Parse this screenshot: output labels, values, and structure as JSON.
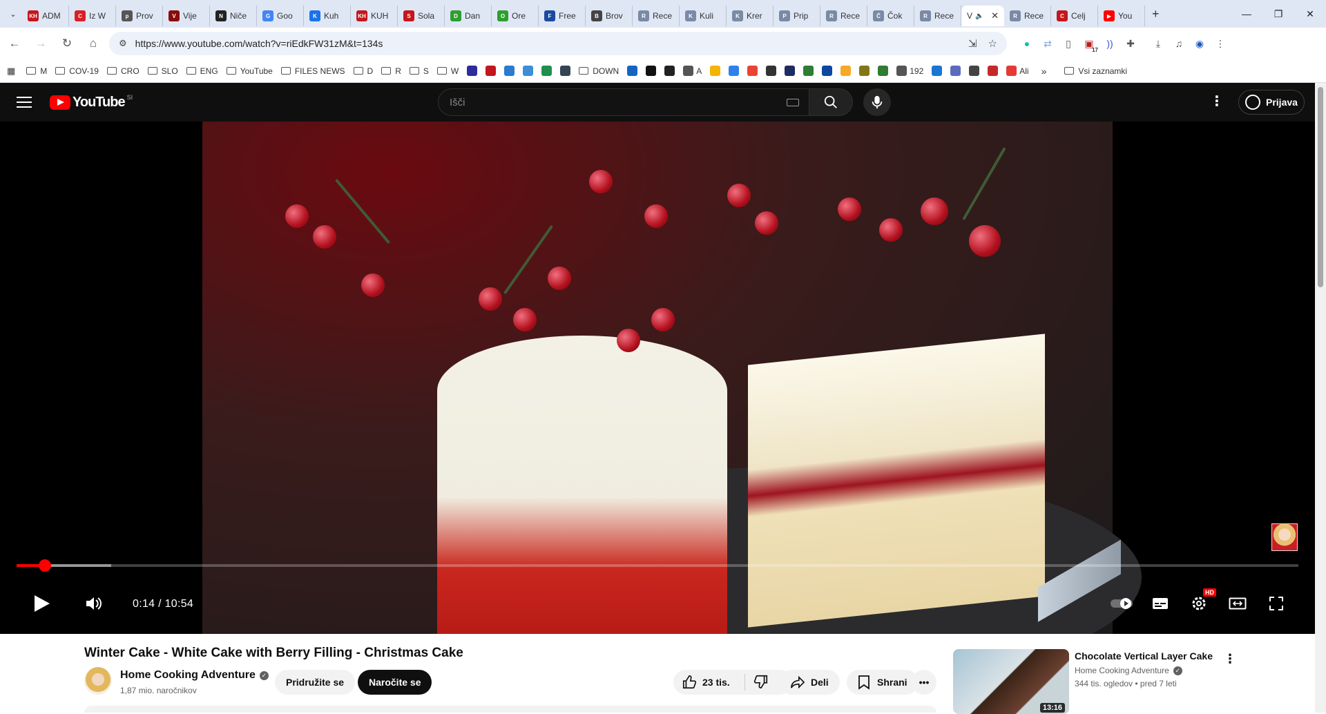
{
  "browser": {
    "tabs": [
      {
        "label": "ADM",
        "color": "#c4161c",
        "fav": "KH"
      },
      {
        "label": "Iz W",
        "color": "#d91f26",
        "fav": "C"
      },
      {
        "label": "Prov",
        "color": "#555555",
        "fav": "p"
      },
      {
        "label": "Vije",
        "color": "#8a0b0b",
        "fav": "V"
      },
      {
        "label": "Niče",
        "color": "#222222",
        "fav": "N"
      },
      {
        "label": "Goo",
        "color": "#4285f4",
        "fav": "G"
      },
      {
        "label": "Kuh",
        "color": "#1a73e8",
        "fav": "K"
      },
      {
        "label": "KUH",
        "color": "#c4161c",
        "fav": "KH"
      },
      {
        "label": "Sola",
        "color": "#c4161c",
        "fav": "S"
      },
      {
        "label": "Dan",
        "color": "#2e9e2e",
        "fav": "D"
      },
      {
        "label": "Ore",
        "color": "#2e9e2e",
        "fav": "O"
      },
      {
        "label": "Free",
        "color": "#1b4aa1",
        "fav": "F"
      },
      {
        "label": "Brov",
        "color": "#444444",
        "fav": "B"
      },
      {
        "label": "Rece",
        "color": "#7a8aa6",
        "fav": "R"
      },
      {
        "label": "Kuli",
        "color": "#7a8aa6",
        "fav": "K"
      },
      {
        "label": "Krer",
        "color": "#7a8aa6",
        "fav": "K"
      },
      {
        "label": "Prip",
        "color": "#7a8aa6",
        "fav": "P"
      },
      {
        "label": "Rece",
        "color": "#7a8aa6",
        "fav": "R"
      },
      {
        "label": "Čok",
        "color": "#7a8aa6",
        "fav": "Č"
      },
      {
        "label": "Rece",
        "color": "#7a8aa6",
        "fav": "R"
      }
    ],
    "active_tab": "V",
    "tabs_after": [
      {
        "label": "Rece",
        "color": "#7a8aa6",
        "fav": "R"
      },
      {
        "label": "Celj",
        "color": "#c4161c",
        "fav": "C"
      },
      {
        "label": "You",
        "color": "#ff0000",
        "fav": "▶"
      }
    ],
    "new_tab": "+",
    "url": "https://www.youtube.com/watch?v=riEdkFW31zM&t=134s",
    "ext_badge": "17",
    "bookmarks": [
      {
        "label": "M",
        "type": "folder"
      },
      {
        "label": "COV-19",
        "type": "folder"
      },
      {
        "label": "CRO",
        "type": "folder"
      },
      {
        "label": "SLO",
        "type": "folder"
      },
      {
        "label": "ENG",
        "type": "folder"
      },
      {
        "label": "YouTube",
        "type": "folder"
      },
      {
        "label": "FILES NEWS",
        "type": "folder"
      },
      {
        "label": "D",
        "type": "folder"
      },
      {
        "label": "R",
        "type": "folder"
      },
      {
        "label": "S",
        "type": "folder"
      },
      {
        "label": "W",
        "type": "folder"
      },
      {
        "label": "",
        "type": "icon",
        "color": "#2c2c9c"
      },
      {
        "label": "",
        "type": "icon",
        "color": "#c4161c"
      },
      {
        "label": "",
        "type": "icon",
        "color": "#2b7bd0"
      },
      {
        "label": "",
        "type": "icon",
        "color": "#3a8fd6"
      },
      {
        "label": "",
        "type": "icon",
        "color": "#1f8f4e"
      },
      {
        "label": "",
        "type": "icon",
        "color": "#334455"
      },
      {
        "label": "DOWN",
        "type": "folder"
      },
      {
        "label": "",
        "type": "icon",
        "color": "#1565c0"
      },
      {
        "label": "",
        "type": "icon",
        "color": "#111111"
      },
      {
        "label": "",
        "type": "icon",
        "color": "#222222"
      },
      {
        "label": "A",
        "type": "icon",
        "color": "#555555"
      },
      {
        "label": "",
        "type": "icon",
        "color": "#f4b400"
      },
      {
        "label": "",
        "type": "icon",
        "color": "#2f80ed"
      },
      {
        "label": "",
        "type": "icon",
        "color": "#ea4335"
      },
      {
        "label": "",
        "type": "icon",
        "color": "#333333"
      },
      {
        "label": "",
        "type": "icon",
        "color": "#1d2b64"
      },
      {
        "label": "",
        "type": "icon",
        "color": "#2e7d32"
      },
      {
        "label": "",
        "type": "icon",
        "color": "#0d47a1"
      },
      {
        "label": "",
        "type": "icon",
        "color": "#f9a825"
      },
      {
        "label": "",
        "type": "icon",
        "color": "#827717"
      },
      {
        "label": "",
        "type": "icon",
        "color": "#2e7d32"
      },
      {
        "label": "192",
        "type": "icon",
        "color": "#555555"
      },
      {
        "label": "",
        "type": "icon",
        "color": "#1976d2"
      },
      {
        "label": "",
        "type": "icon",
        "color": "#5c6bc0"
      },
      {
        "label": "",
        "type": "icon",
        "color": "#444444"
      },
      {
        "label": "",
        "type": "icon",
        "color": "#c62828"
      },
      {
        "label": "Ali",
        "type": "icon",
        "color": "#e53935"
      }
    ],
    "bookmarks_more": "»",
    "all_bookmarks": "Vsi zaznamki"
  },
  "youtube": {
    "logo_text": "YouTube",
    "country_code": "SI",
    "search_placeholder": "Išči",
    "signin": "Prijava"
  },
  "player": {
    "current_time": "0:14",
    "duration": "10:54",
    "time_display": "0:14 / 10:54",
    "progress_fraction": 0.022,
    "buffered_fraction": 0.074,
    "hd_badge": "HD",
    "accent": "#ff0000"
  },
  "video": {
    "title": "Winter Cake - White Cake with Berry Filling - Christmas Cake",
    "channel": "Home Cooking Adventure",
    "subscribers": "1,87 mio. naročnikov",
    "join": "Pridružite se",
    "subscribe": "Naročite se",
    "likes": "23 tis.",
    "share": "Deli",
    "save": "Shrani"
  },
  "recommended": {
    "title": "Chocolate Vertical Layer Cake",
    "channel": "Home Cooking Adventure",
    "meta": "344 tis. ogledov • pred 7 leti",
    "duration": "13:16"
  }
}
